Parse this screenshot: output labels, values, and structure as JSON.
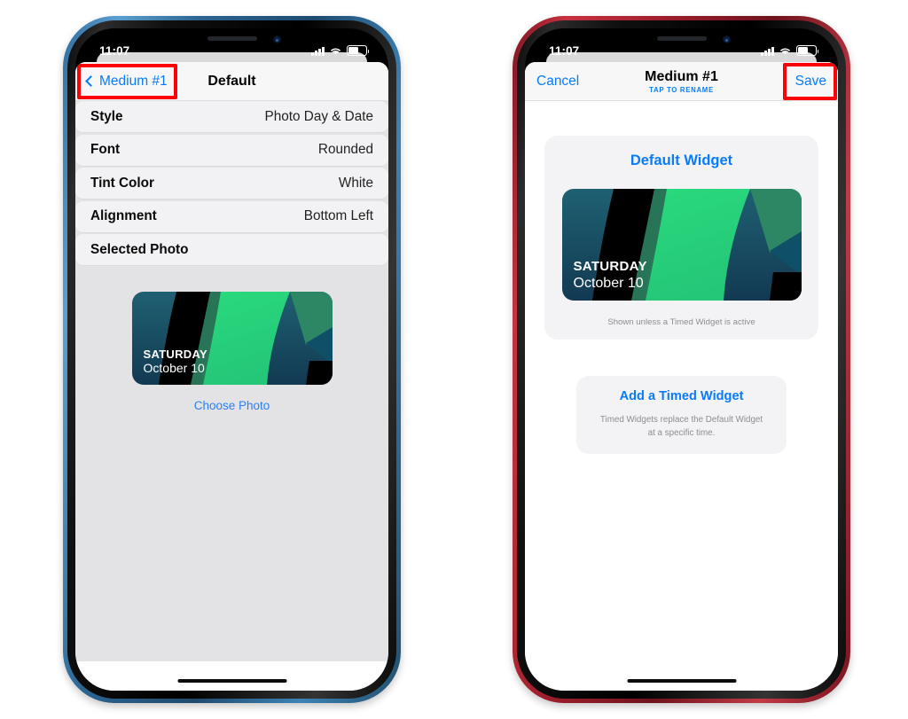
{
  "colors": {
    "ios_blue": "#0a7bf7",
    "highlight_red": "#fb0007",
    "list_bg": "#e3e3e5",
    "card_bg": "#f3f3f5",
    "left_phone_frame": "#2c6491",
    "right_phone_frame": "#9e1f2c",
    "widget_green": "#2CD77E",
    "widget_teal": "#1d5568",
    "widget_dark": "#000000"
  },
  "left_phone": {
    "status_bar": {
      "time": "11:07",
      "cellular": "signal-bars",
      "wifi": "wifi-icon",
      "battery": "battery-icon"
    },
    "nav": {
      "back_label": "Medium #1",
      "title": "Default",
      "back_highlighted": true
    },
    "rows": [
      {
        "label": "Style",
        "value": "Photo Day & Date"
      },
      {
        "label": "Font",
        "value": "Rounded"
      },
      {
        "label": "Tint Color",
        "value": "White"
      },
      {
        "label": "Alignment",
        "value": "Bottom Left"
      },
      {
        "label": "Selected Photo",
        "value": ""
      }
    ],
    "widget": {
      "day": "SATURDAY",
      "date": "October 10"
    },
    "choose_photo_label": "Choose Photo"
  },
  "right_phone": {
    "status_bar": {
      "time": "11:07",
      "cellular": "signal-bars",
      "wifi": "wifi-icon",
      "battery": "battery-icon"
    },
    "nav": {
      "cancel_label": "Cancel",
      "title": "Medium #1",
      "subtitle": "TAP TO RENAME",
      "save_label": "Save",
      "save_highlighted": true
    },
    "default_card": {
      "title": "Default Widget",
      "widget": {
        "day": "SATURDAY",
        "date": "October 10"
      },
      "note": "Shown unless a Timed Widget is active"
    },
    "timed_card": {
      "title": "Add a Timed Widget",
      "note": "Timed Widgets replace the Default Widget at a specific time."
    }
  }
}
